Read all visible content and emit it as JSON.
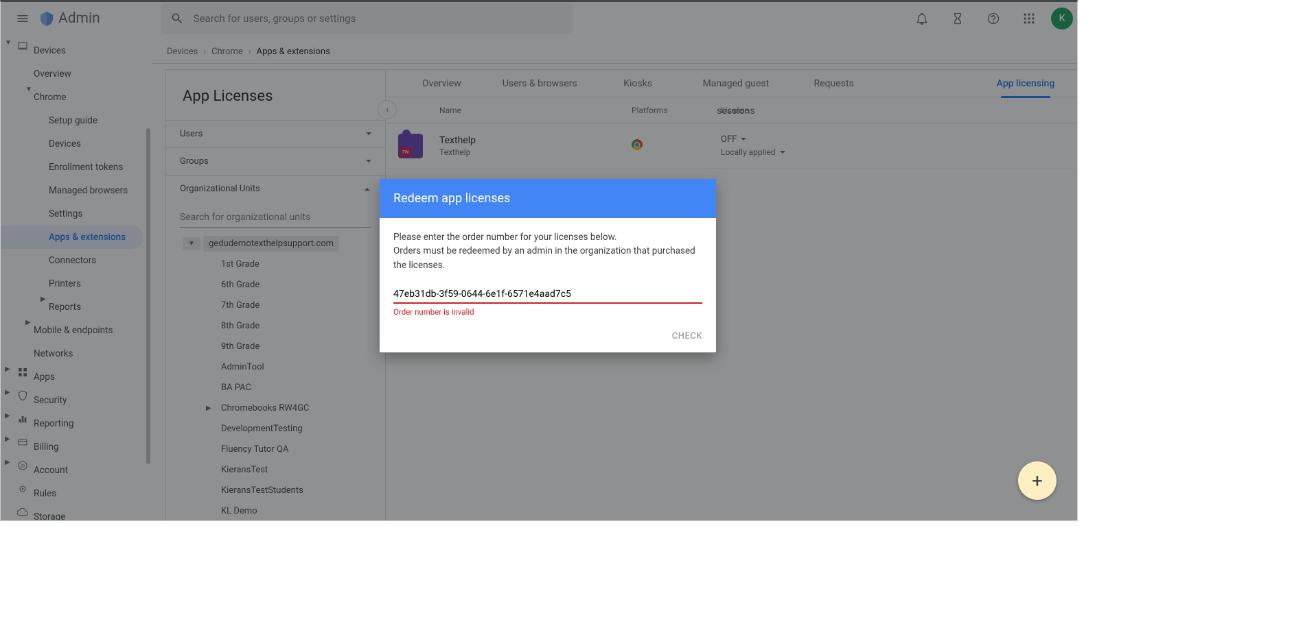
{
  "header": {
    "title": "Admin",
    "search_placeholder": "Search for users, groups or settings",
    "avatar_initial": "K"
  },
  "sidenav": {
    "devices": "Devices",
    "overview": "Overview",
    "chrome": "Chrome",
    "setup_guide": "Setup guide",
    "devices_sub": "Devices",
    "enrollment_tokens": "Enrollment tokens",
    "managed_browsers": "Managed browsers",
    "settings": "Settings",
    "apps_extensions": "Apps & extensions",
    "connectors": "Connectors",
    "printers": "Printers",
    "reports": "Reports",
    "mobile_endpoints": "Mobile & endpoints",
    "networks": "Networks",
    "apps": "Apps",
    "security": "Security",
    "reporting": "Reporting",
    "billing": "Billing",
    "account": "Account",
    "rules": "Rules",
    "storage": "Storage"
  },
  "breadcrumb": {
    "b1": "Devices",
    "b2": "Chrome",
    "b3": "Apps & extensions"
  },
  "orgpane": {
    "title": "App Licenses",
    "users": "Users",
    "groups": "Groups",
    "org_units": "Organizational Units",
    "search_placeholder": "Search for organizational units",
    "root": "gedudemotexthelpsupport.com",
    "items": [
      "1st Grade",
      "6th Grade",
      "7th Grade",
      "8th Grade",
      "9th Grade",
      "AdminTool",
      "BA PAC",
      "Chromebooks RW4GC",
      "DevelopmentTesting",
      "Fluency Tutor QA",
      "KieransTest",
      "KieransTestStudents",
      "KL Demo"
    ]
  },
  "tabs": {
    "overview": "Overview",
    "users_browsers": "Users & browsers",
    "kiosks": "Kiosks",
    "guest": "Managed guest sessions",
    "requests": "Requests",
    "licensing": "App licensing"
  },
  "table": {
    "col_name": "Name",
    "col_platforms": "Platforms",
    "col_license": "License",
    "row": {
      "title": "Texthelp",
      "subtitle": "Texthelp",
      "icon_rw": "rw",
      "license_state": "OFF",
      "license_scope": "Locally applied"
    }
  },
  "dialog": {
    "title": "Redeem app licenses",
    "line1": "Please enter the order number for your licenses below.",
    "line2": "Orders must be redeemed by an admin in the organization that purchased the licenses.",
    "input_value": "47eb31db-3f59-0644-6e1f-6571e4aad7c5",
    "error": "Order number is invalid",
    "check": "CHECK"
  },
  "fab": "+"
}
